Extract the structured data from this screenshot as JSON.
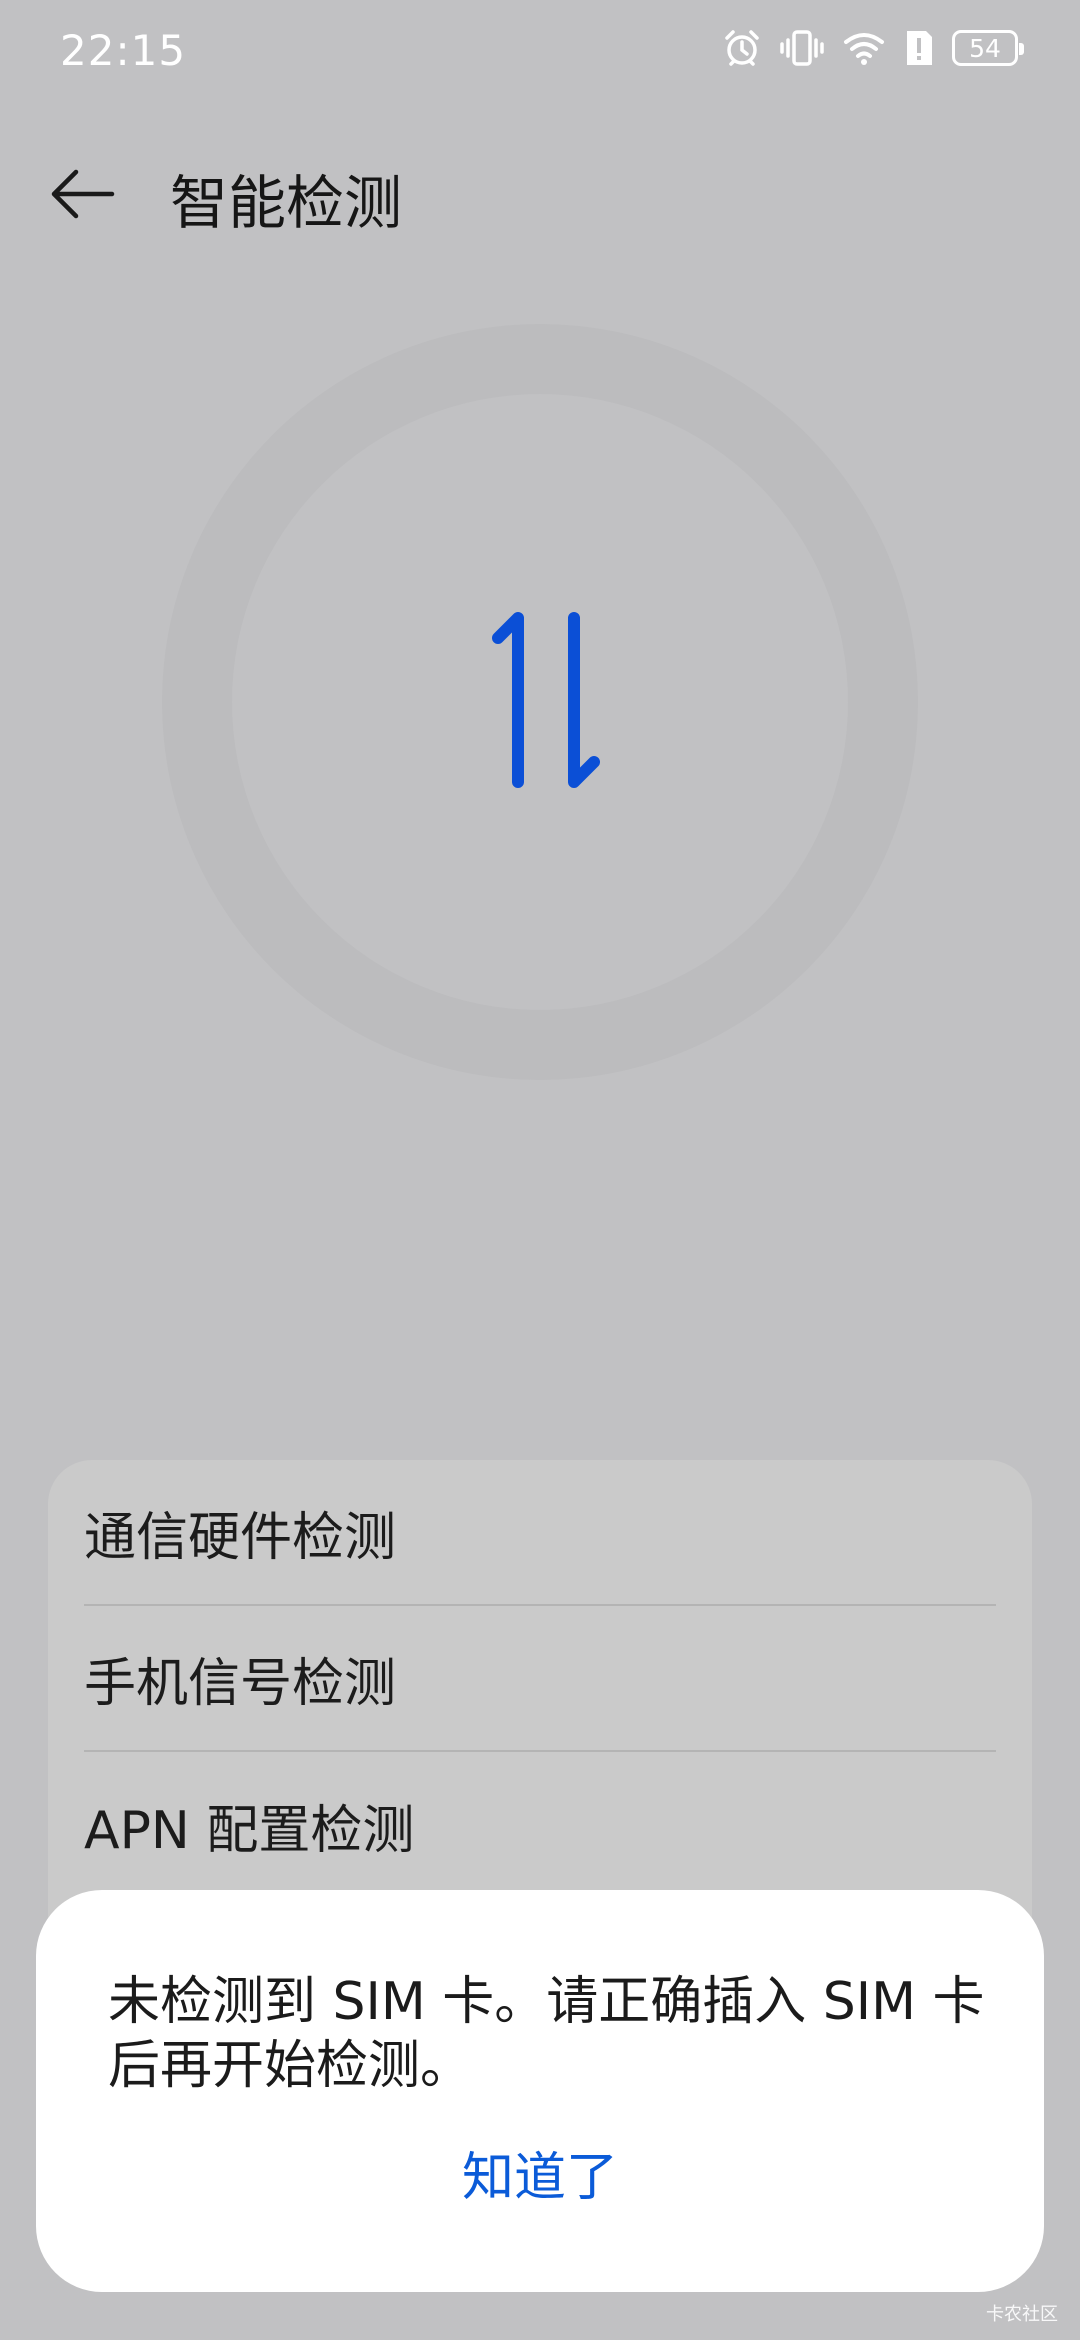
{
  "status_bar": {
    "time": "22:15",
    "battery_level": "54",
    "icons": [
      "alarm-icon",
      "vibrate-icon",
      "wifi-icon",
      "alert-icon",
      "battery-icon"
    ]
  },
  "header": {
    "title": "智能检测",
    "back_icon": "arrow-left-icon"
  },
  "center": {
    "icon": "data-transfer-icon",
    "accent_color": "#0b4fd6"
  },
  "check_list": {
    "items": [
      {
        "label": "通信硬件检测"
      },
      {
        "label": "手机信号检测"
      },
      {
        "label": "APN 配置检测"
      }
    ]
  },
  "dialog": {
    "message": "未检测到 SIM 卡。请正确插入 SIM 卡后再开始检测。",
    "ok_label": "知道了",
    "ok_color": "#0b5bd8"
  },
  "watermark": {
    "text": "卡农社区"
  }
}
